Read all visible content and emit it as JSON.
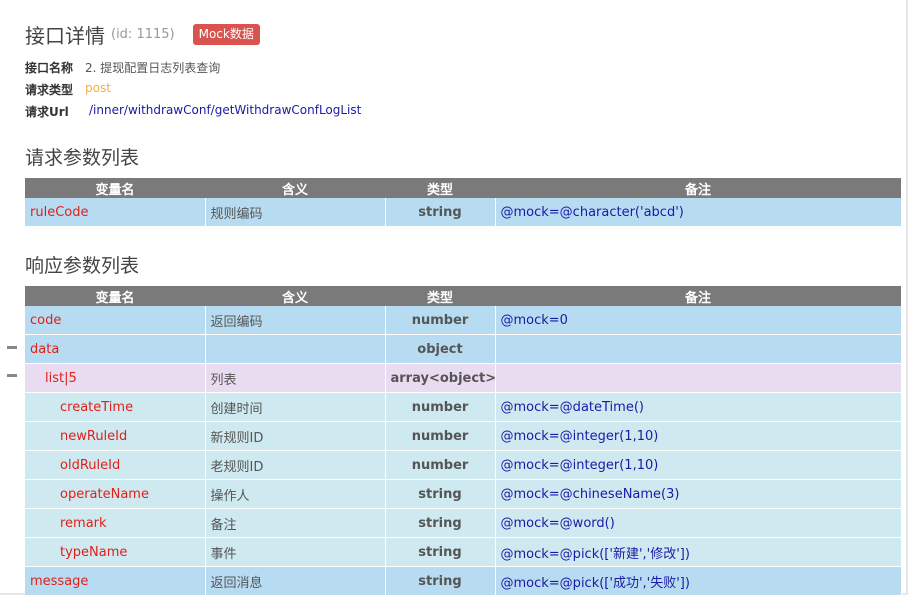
{
  "header": {
    "title": "接口详情",
    "id_text": "(id: 1115)",
    "mock_button": "Mock数据"
  },
  "meta": {
    "name_label": "接口名称",
    "name_value": "2. 提现配置日志列表查询",
    "type_label": "请求类型",
    "type_value": "post",
    "url_label": "请求Url",
    "url_value": "/inner/withdrawConf/getWithdrawConfLogList"
  },
  "request": {
    "section_title": "请求参数列表",
    "columns": [
      "变量名",
      "含义",
      "类型",
      "备注"
    ],
    "rows": [
      {
        "name": "ruleCode",
        "desc": "规则编码",
        "type": "string",
        "note": "@mock=@character('abcd')"
      }
    ]
  },
  "response": {
    "section_title": "响应参数列表",
    "columns": [
      "变量名",
      "含义",
      "类型",
      "备注"
    ],
    "rows": [
      {
        "name": "code",
        "desc": "返回编码",
        "type": "number",
        "note": "@mock=0"
      },
      {
        "name": "data",
        "desc": "",
        "type": "object",
        "note": ""
      },
      {
        "name": "list|5",
        "desc": "列表",
        "type": "array<object>",
        "note": ""
      },
      {
        "name": "createTime",
        "desc": "创建时间",
        "type": "number",
        "note": "@mock=@dateTime()"
      },
      {
        "name": "newRuleId",
        "desc": "新规则ID",
        "type": "number",
        "note": "@mock=@integer(1,10)"
      },
      {
        "name": "oldRuleId",
        "desc": "老规则ID",
        "type": "number",
        "note": "@mock=@integer(1,10)"
      },
      {
        "name": "operateName",
        "desc": "操作人",
        "type": "string",
        "note": "@mock=@chineseName(3)"
      },
      {
        "name": "remark",
        "desc": "备注",
        "type": "string",
        "note": "@mock=@word()"
      },
      {
        "name": "typeName",
        "desc": "事件",
        "type": "string",
        "note": "@mock=@pick(['新建','修改'])"
      },
      {
        "name": "message",
        "desc": "返回消息",
        "type": "string",
        "note": "@mock=@pick(['成功','失败'])"
      }
    ]
  }
}
